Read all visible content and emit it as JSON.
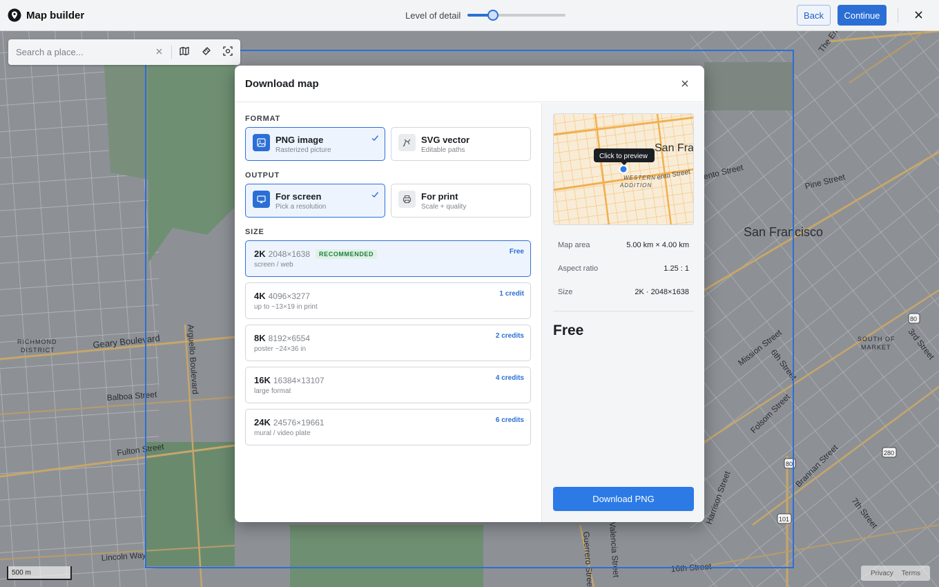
{
  "app": {
    "title": "Map builder",
    "level_of_detail_label": "Level of detail",
    "level_of_detail_value": 0.26,
    "back_label": "Back",
    "continue_label": "Continue"
  },
  "search": {
    "placeholder": "Search a place..."
  },
  "map_labels": {
    "richmond": "RICHMOND",
    "district": "DISTRICT",
    "geary": "Geary Boulevard",
    "balboa": "Balboa Street",
    "fulton": "Fulton Street",
    "lincoln": "Lincoln Way",
    "arguello": "Arguello Boulevard",
    "sf": "San Francisco",
    "pine": "Pine Street",
    "sacramento": "ento Street",
    "south_of": "SOUTH OF",
    "market": "MARKET",
    "mission": "Mission Street",
    "sixth": "6th Street",
    "third": "3rd Street",
    "folsom": "Folsom Street",
    "brannan": "Brannan Street",
    "seventh": "7th Street",
    "harrison": "Harrison Street",
    "guerrero": "Guerrero Street",
    "valencia": "Valencia Street",
    "sixteenth": "16th Street",
    "embarcadero": "The Embarcadero",
    "hwy80": "80",
    "hwy280": "280",
    "hwy101": "101",
    "hwy80b": "80"
  },
  "modal": {
    "title": "Download map",
    "format": {
      "label": "FORMAT",
      "options": [
        {
          "title": "PNG image",
          "sub": "Rasterized picture",
          "selected": true
        },
        {
          "title": "SVG vector",
          "sub": "Editable paths",
          "selected": false
        }
      ]
    },
    "output": {
      "label": "OUTPUT",
      "options": [
        {
          "title": "For screen",
          "sub": "Pick a resolution",
          "selected": true
        },
        {
          "title": "For print",
          "sub": "Scale + quality",
          "selected": false
        }
      ]
    },
    "size": {
      "label": "SIZE",
      "recommended_badge": "RECOMMENDED",
      "options": [
        {
          "name": "2K",
          "dims": "2048×1638",
          "desc": "screen / web",
          "cost": "Free",
          "selected": true
        },
        {
          "name": "4K",
          "dims": "4096×3277",
          "desc": "up to ~13×19 in print",
          "cost": "1 credit",
          "selected": false
        },
        {
          "name": "8K",
          "dims": "8192×6554",
          "desc": "poster ~24×36 in",
          "cost": "2 credits",
          "selected": false
        },
        {
          "name": "16K",
          "dims": "16384×13107",
          "desc": "large format",
          "cost": "4 credits",
          "selected": false
        },
        {
          "name": "24K",
          "dims": "24576×19661",
          "desc": "mural / video plate",
          "cost": "6 credits",
          "selected": false
        }
      ]
    },
    "preview": {
      "tooltip": "Click to preview",
      "label_city": "San Fra",
      "label_street": "ento Street",
      "label_area_1": "WESTERN",
      "label_area_2": "ADDITION"
    },
    "summary": {
      "rows": [
        {
          "label": "Map area",
          "value": "5.00 km × 4.00 km"
        },
        {
          "label": "Aspect ratio",
          "value": "1.25 : 1"
        },
        {
          "label": "Size",
          "value": "2K · 2048×1638"
        }
      ],
      "price": "Free",
      "download_label": "Download PNG"
    }
  },
  "footer": {
    "scale_label": "500 m",
    "privacy": "Privacy",
    "terms": "Terms"
  },
  "colors": {
    "accent": "#2b6fd6",
    "selected_bg": "#eef4fd",
    "badge_green": "#1e7a3e"
  }
}
